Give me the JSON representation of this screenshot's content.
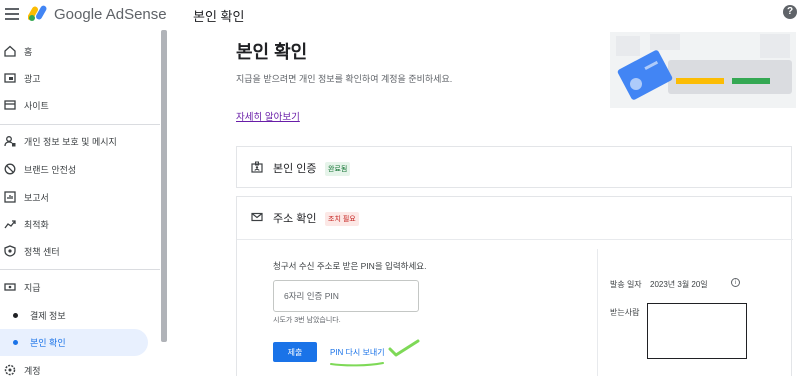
{
  "app": {
    "brand_google": "Google",
    "brand_product": "AdSense",
    "page_header": "본인 확인",
    "help": "?"
  },
  "sidebar": {
    "items": [
      {
        "label": "홈",
        "icon": "home-icon"
      },
      {
        "label": "광고",
        "icon": "ads-icon"
      },
      {
        "label": "사이트",
        "icon": "sites-icon"
      },
      {
        "label": "개인 정보 보호 및 메시지",
        "icon": "privacy-icon"
      },
      {
        "label": "브랜드 안전성",
        "icon": "block-icon"
      },
      {
        "label": "보고서",
        "icon": "reports-icon"
      },
      {
        "label": "최적화",
        "icon": "optimization-icon"
      },
      {
        "label": "정책 센터",
        "icon": "policy-icon"
      },
      {
        "label": "지급",
        "icon": "payments-icon"
      },
      {
        "label": "결제 정보",
        "icon": ""
      },
      {
        "label": "본인 확인",
        "icon": ""
      },
      {
        "label": "계정",
        "icon": "account-icon"
      }
    ]
  },
  "main": {
    "title": "본인 확인",
    "description": "지급을 받으려면 개인 정보를 확인하여 계정을 준비하세요.",
    "learn_more": "자세히 알아보기"
  },
  "cards": {
    "identity": {
      "title": "본인 인증",
      "badge": "완료됨"
    },
    "address": {
      "title": "주소 확인",
      "badge": "조치 필요",
      "instruction": "청구서 수신 주소로 받은 PIN을 입력하세요.",
      "pin_placeholder": "6자리 인증 PIN",
      "hint": "시도가 3번 남았습니다.",
      "submit": "제출",
      "resend": "PIN 다시 보내기",
      "sent_date_label": "발송 일자",
      "sent_date_value": "2023년 3월 20일",
      "recipient_label": "받는사람"
    }
  },
  "colors": {
    "accent": "#1a73e8",
    "done_badge_bg": "#e6f4ea",
    "required_badge_bg": "#fce8e6",
    "check_annotation": "#7ed957"
  }
}
